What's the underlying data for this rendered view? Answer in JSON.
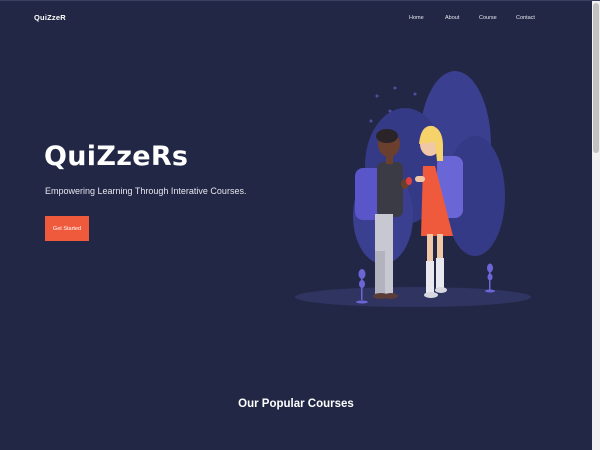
{
  "header": {
    "brand": "QuiZzeR",
    "nav": [
      {
        "label": "Home"
      },
      {
        "label": "About"
      },
      {
        "label": "Course"
      },
      {
        "label": "Contact"
      }
    ]
  },
  "hero": {
    "title": "QuiZzeRs",
    "subtitle": "Empowering Learning Through Interative Courses.",
    "cta_label": "Get Started",
    "illustration": "two-students-with-backpacks"
  },
  "popular": {
    "title": "Our Popular Courses"
  },
  "colors": {
    "background": "#222745",
    "accent": "#ef5a3c",
    "illustration_purple": "#5a55c8"
  }
}
